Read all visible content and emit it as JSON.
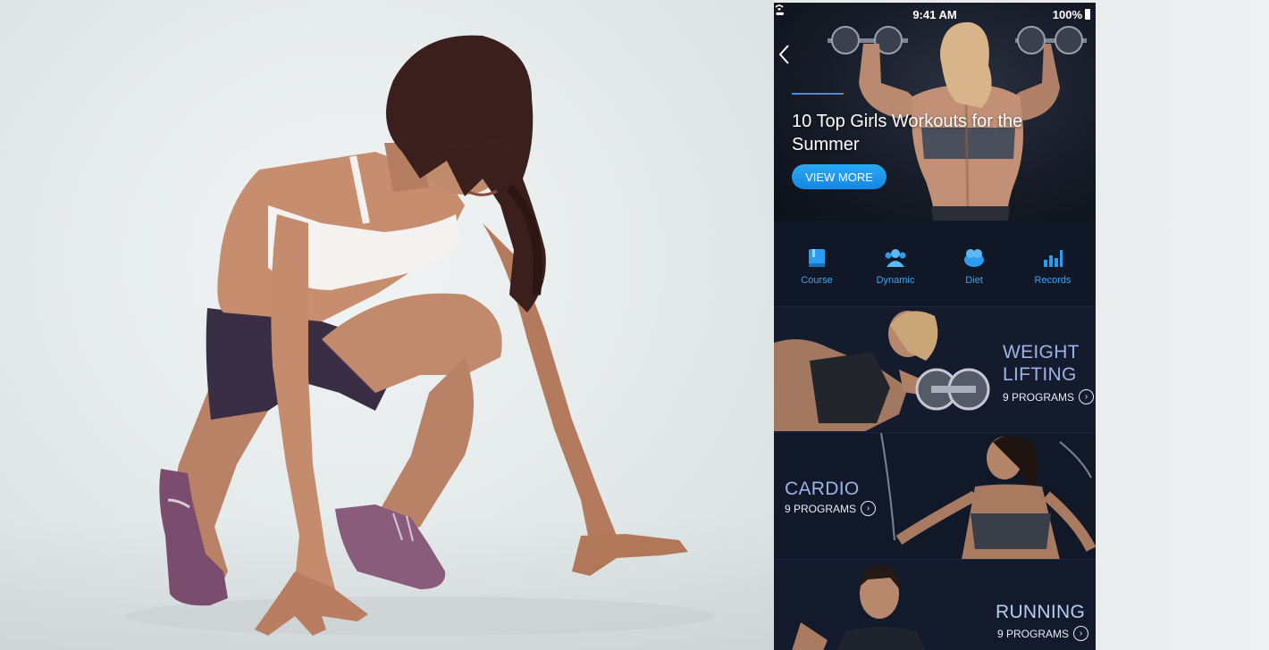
{
  "status_bar": {
    "signal": "••••",
    "time": "9:41 AM",
    "battery": "100%"
  },
  "banner": {
    "title": "10 Top Girls Workouts for the Summer",
    "button_label": "VIEW MORE"
  },
  "nav": {
    "items": [
      {
        "label": "Course",
        "icon": "book-icon"
      },
      {
        "label": "Dynamic",
        "icon": "users-icon"
      },
      {
        "label": "Diet",
        "icon": "food-icon"
      },
      {
        "label": "Records",
        "icon": "bar-chart-icon"
      }
    ]
  },
  "programs": [
    {
      "title_line1": "WEIGHT",
      "title_line2": "LIFTING",
      "count": "9 PROGRAMS"
    },
    {
      "title_line1": "CARDIO",
      "title_line2": "",
      "count": "9 PROGRAMS"
    },
    {
      "title_line1": "RUNNING",
      "title_line2": "",
      "count": "9 PROGRAMS"
    }
  ],
  "colors": {
    "accent": "#1e96ee",
    "nav_label": "#3ba7f3",
    "card_title": "#9bb3e8",
    "phone_bg": "#0e1424"
  }
}
